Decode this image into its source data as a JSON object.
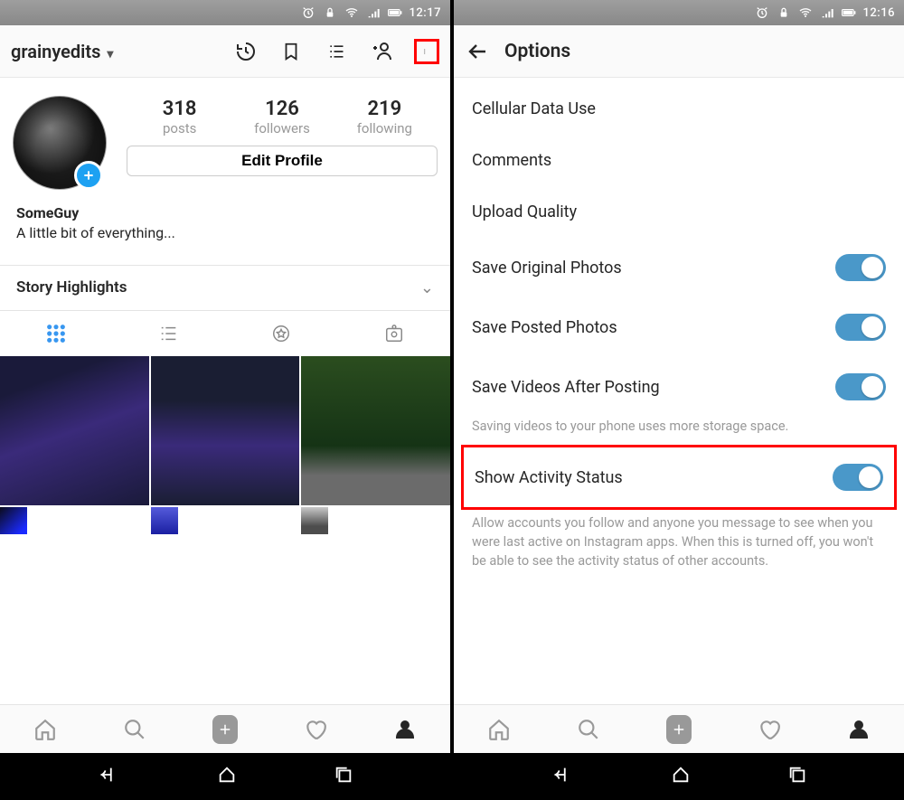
{
  "left": {
    "statusbar": {
      "time": "12:17"
    },
    "header": {
      "username": "grainyedits",
      "history_icon": "history-icon",
      "bookmark_icon": "bookmark-icon",
      "list_icon": "list-icon",
      "addperson_icon": "add-person-icon",
      "menu_icon": "menu-icon"
    },
    "stats": {
      "posts_count": "318",
      "posts_label": "posts",
      "followers_count": "126",
      "followers_label": "followers",
      "following_count": "219",
      "following_label": "following"
    },
    "edit_profile_label": "Edit Profile",
    "bio": {
      "name": "SomeGuy",
      "desc": "A little bit of everything..."
    },
    "story_highlights_label": "Story Highlights",
    "tabs": {
      "grid": "grid",
      "list": "list",
      "tagged": "tagged",
      "saved": "saved"
    }
  },
  "right": {
    "statusbar": {
      "time": "12:16"
    },
    "header": {
      "title": "Options"
    },
    "options": {
      "cellular": "Cellular Data Use",
      "comments": "Comments",
      "upload_quality": "Upload Quality",
      "save_original": "Save Original Photos",
      "save_posted": "Save Posted Photos",
      "save_videos": "Save Videos After Posting",
      "save_videos_help": "Saving videos to your phone uses more storage space.",
      "activity_status": "Show Activity Status",
      "activity_help": "Allow accounts you follow and anyone you message to see when you were last active on Instagram apps. When this is turned off, you won't be able to see the activity status of other accounts."
    }
  },
  "bottomnav": {
    "home": "home",
    "search": "search",
    "add": "add",
    "activity": "activity",
    "profile": "profile"
  },
  "androidnav": {
    "back": "back",
    "home": "home",
    "recents": "recents"
  }
}
